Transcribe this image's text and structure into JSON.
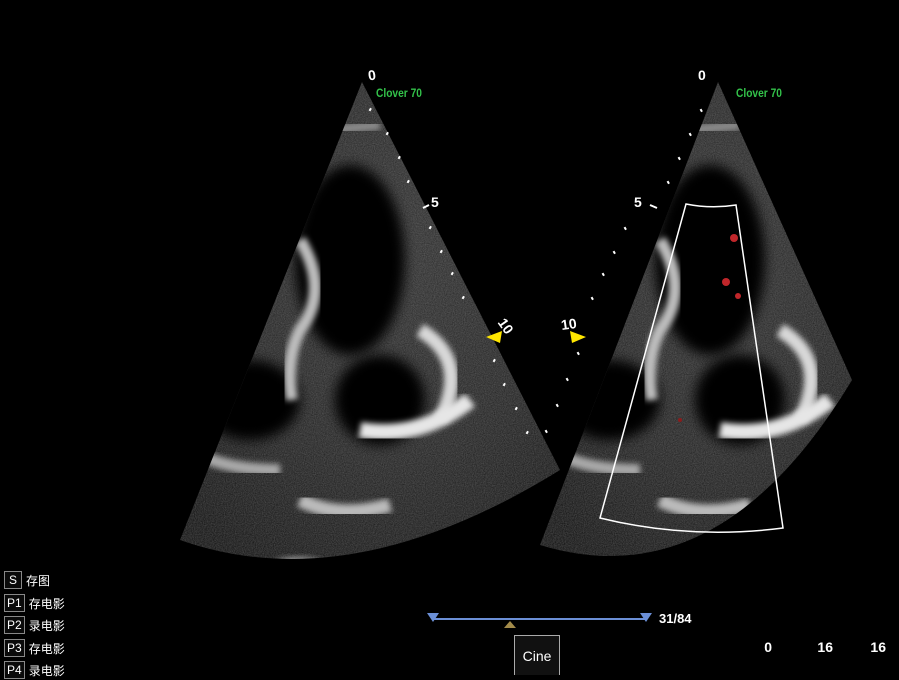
{
  "left_image": {
    "probe_label": "Clover 70",
    "depth_labels": [
      "0",
      "5",
      "10"
    ]
  },
  "right_image": {
    "probe_label": "Clover 70",
    "depth_labels": [
      "0",
      "5",
      "10"
    ],
    "color_box": true
  },
  "shortcuts": [
    {
      "key": "S",
      "label": "存图"
    },
    {
      "key": "P1",
      "label": "存电影"
    },
    {
      "key": "P2",
      "label": "录电影"
    },
    {
      "key": "P3",
      "label": "存电影"
    },
    {
      "key": "P4",
      "label": "录电影"
    }
  ],
  "cine_bar": {
    "frame_counter": "31/84",
    "button_label": "Cine",
    "current_frame": 31,
    "total_frames": 84
  },
  "status_values": [
    "0",
    "16",
    "16"
  ],
  "colors": {
    "brand": "#33c24a",
    "marker": "#ffe600",
    "slider": "#6b8fd6",
    "doppler": "#c0262a"
  }
}
